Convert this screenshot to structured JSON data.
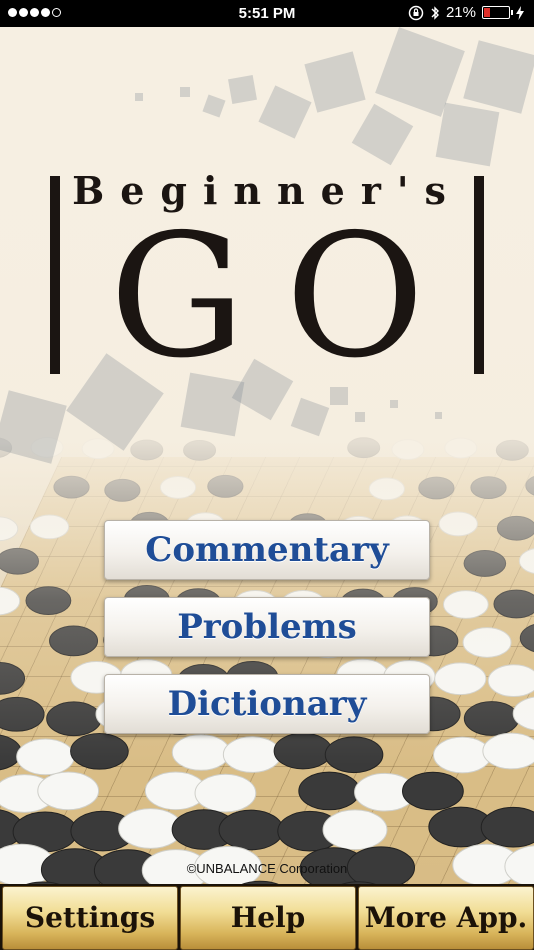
{
  "status_bar": {
    "time": "5:51 PM",
    "battery_percent": "21%",
    "battery_level": 0.21,
    "signal_bars": 4,
    "icons": [
      "orientation-lock-icon",
      "bluetooth-icon",
      "battery-icon",
      "charging-bolt-icon"
    ]
  },
  "logo": {
    "line1": "Beginner's",
    "line2": "GO"
  },
  "menu": {
    "commentary": "Commentary",
    "problems": "Problems",
    "dictionary": "Dictionary"
  },
  "copyright": "©UNBALANCE Corporation",
  "bottom_bar": {
    "settings": "Settings",
    "help": "Help",
    "more_app": "More App."
  },
  "colors": {
    "menu_text": "#1f4d97",
    "logo_text": "#1b1512",
    "tab_gold": "#f1dd95",
    "battery_low": "#e0302a"
  }
}
